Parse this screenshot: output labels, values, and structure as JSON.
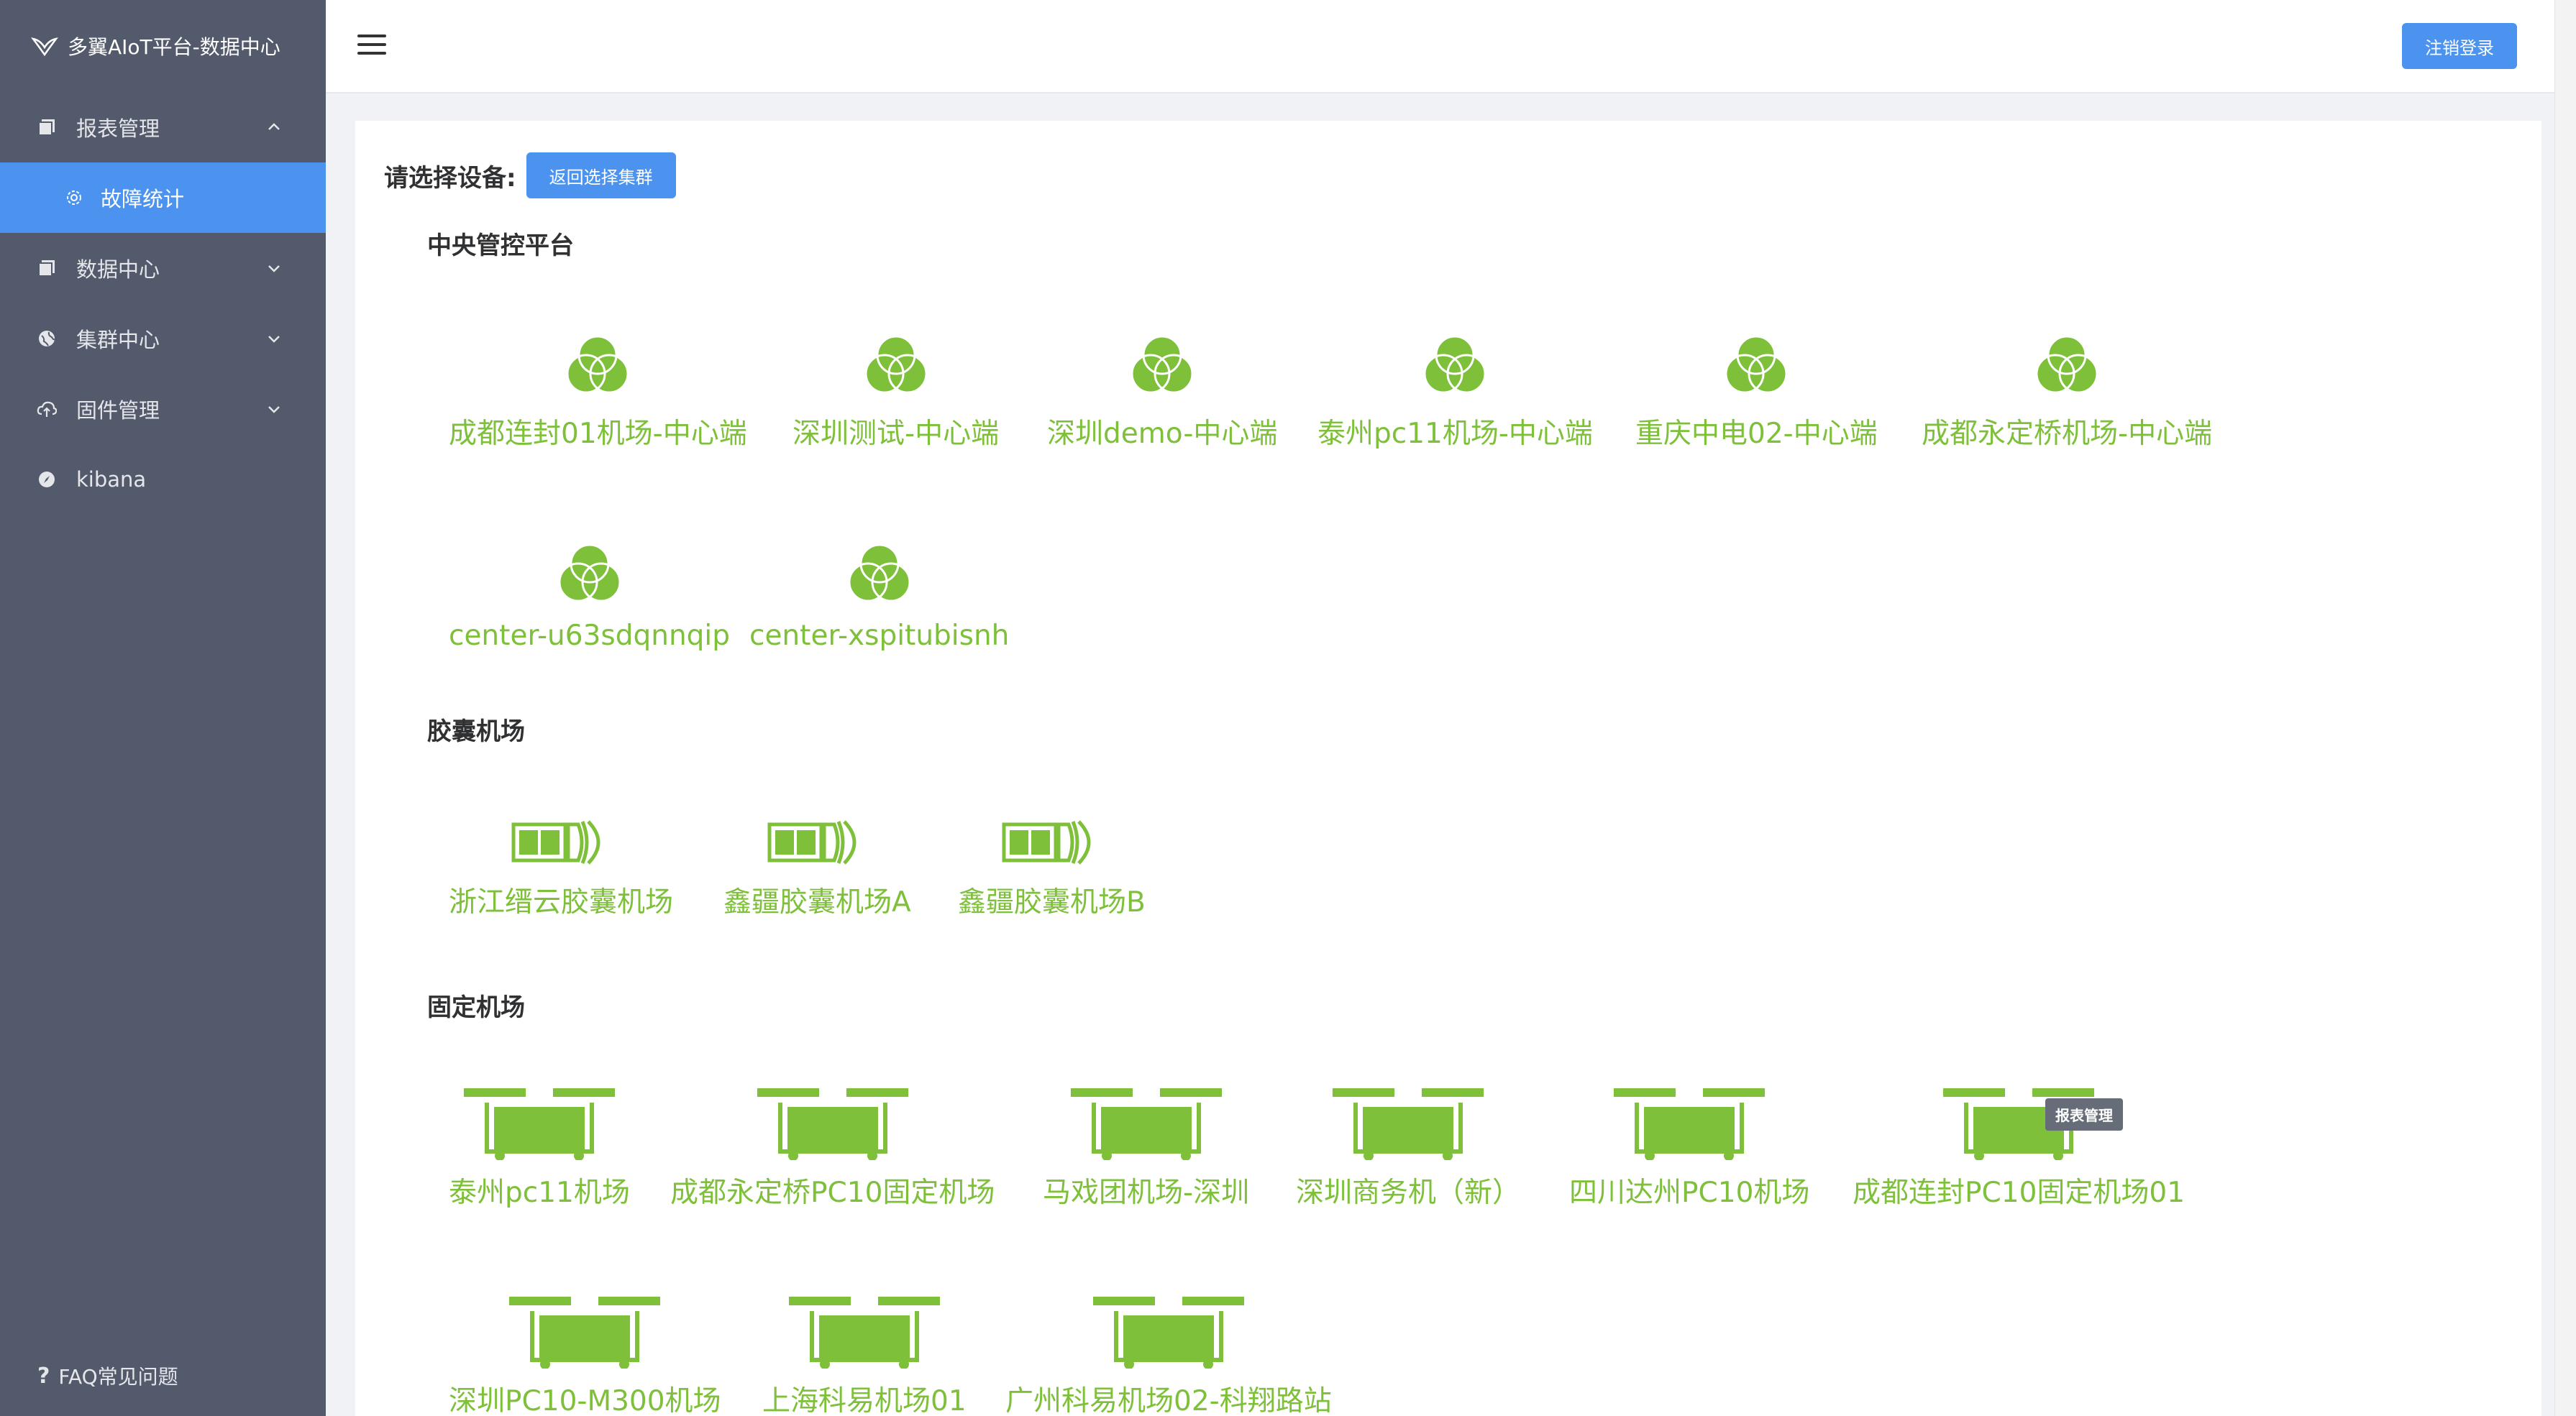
{
  "app": {
    "title": "多翼AIoT平台-数据中心"
  },
  "sidebar": {
    "items": [
      {
        "label": "报表管理",
        "icon": "report-icon",
        "expanded": true
      },
      {
        "label": "故障统计",
        "icon": "gear-icon",
        "active": true
      },
      {
        "label": "数据中心",
        "icon": "data-icon",
        "expanded": false
      },
      {
        "label": "集群中心",
        "icon": "globe-icon",
        "expanded": false
      },
      {
        "label": "固件管理",
        "icon": "cloud-upload-icon",
        "expanded": false
      },
      {
        "label": "kibana",
        "icon": "compass-icon"
      }
    ],
    "faq_label": "FAQ常见问题",
    "faq_icon": "?"
  },
  "header": {
    "logout_label": "注销登录",
    "menu_icon": "hamburger-icon"
  },
  "main": {
    "select_label": "请选择设备:",
    "back_button_label": "返回选择集群",
    "sections": [
      {
        "title": "中央管控平台",
        "icon": "center-platform-icon",
        "devices": [
          "成都连封01机场-中心端",
          "深圳测试-中心端",
          "深圳demo-中心端",
          "泰州pc11机场-中心端",
          "重庆中电02-中心端",
          "成都永定桥机场-中心端",
          "center-u63sdqnnqip",
          "center-xspitubisnh"
        ]
      },
      {
        "title": "胶囊机场",
        "icon": "capsule-airport-icon",
        "devices": [
          "浙江缙云胶囊机场",
          "鑫疆胶囊机场A",
          "鑫疆胶囊机场B"
        ]
      },
      {
        "title": "固定机场",
        "icon": "fixed-airport-icon",
        "devices": [
          "泰州pc11机场",
          "成都永定桥PC10固定机场",
          "马戏团机场-深圳",
          "深圳商务机（新）",
          "四川达州PC10机场",
          "成都连封PC10固定机场01",
          "深圳PC10-M300机场",
          "上海科易机场01",
          "广州科易机场02-科翔路站"
        ]
      }
    ],
    "tooltip": "报表管理"
  },
  "colors": {
    "sidebar_bg": "#535a6b",
    "accent": "#4b93ee",
    "device_green": "#7ec03a"
  }
}
